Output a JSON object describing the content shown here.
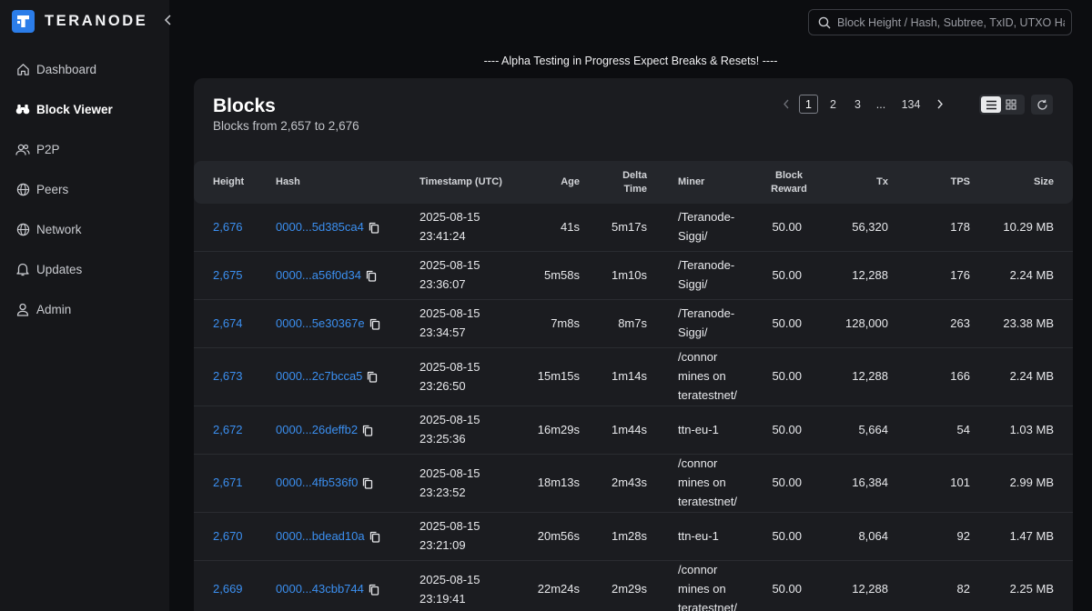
{
  "brand": {
    "name": "TERANODE",
    "logo_icon": "teranode-logo-icon",
    "accent": "#2b7de9"
  },
  "nav": [
    {
      "label": "Dashboard",
      "icon": "home-icon",
      "active": false
    },
    {
      "label": "Block Viewer",
      "icon": "binoculars-icon",
      "active": true
    },
    {
      "label": "P2P",
      "icon": "users-icon",
      "active": false
    },
    {
      "label": "Peers",
      "icon": "globe-icon",
      "active": false
    },
    {
      "label": "Network",
      "icon": "globe-icon",
      "active": false
    },
    {
      "label": "Updates",
      "icon": "bell-icon",
      "active": false
    },
    {
      "label": "Admin",
      "icon": "user-icon",
      "active": false
    }
  ],
  "search": {
    "placeholder": "Block Height / Hash, Subtree, TxID, UTXO Hash"
  },
  "banner": "---- Alpha Testing in Progress Expect Breaks & Resets! ----",
  "card": {
    "title": "Blocks",
    "subtitle": "Blocks from 2,657 to 2,676"
  },
  "pagination": {
    "pages": [
      "1",
      "2",
      "3",
      "...",
      "134"
    ],
    "current": "1"
  },
  "view_mode": "list",
  "table": {
    "headers": {
      "height": "Height",
      "hash": "Hash",
      "timestamp": "Timestamp (UTC)",
      "age": "Age",
      "delta_1": "Delta",
      "delta_2": "Time",
      "miner": "Miner",
      "reward_1": "Block",
      "reward_2": "Reward",
      "tx": "Tx",
      "tps": "TPS",
      "size": "Size"
    },
    "rows": [
      {
        "height": "2,676",
        "hash": "0000...5d385ca4",
        "date": "2025-08-15",
        "time": "23:41:24",
        "age": "41s",
        "delta": "5m17s",
        "miner_1": "/Teranode-",
        "miner_2": "Siggi/",
        "miner_3": "",
        "reward": "50.00",
        "tx": "56,320",
        "tps": "178",
        "size": "10.29 MB"
      },
      {
        "height": "2,675",
        "hash": "0000...a56f0d34",
        "date": "2025-08-15",
        "time": "23:36:07",
        "age": "5m58s",
        "delta": "1m10s",
        "miner_1": "/Teranode-",
        "miner_2": "Siggi/",
        "miner_3": "",
        "reward": "50.00",
        "tx": "12,288",
        "tps": "176",
        "size": "2.24 MB"
      },
      {
        "height": "2,674",
        "hash": "0000...5e30367e",
        "date": "2025-08-15",
        "time": "23:34:57",
        "age": "7m8s",
        "delta": "8m7s",
        "miner_1": "/Teranode-",
        "miner_2": "Siggi/",
        "miner_3": "",
        "reward": "50.00",
        "tx": "128,000",
        "tps": "263",
        "size": "23.38 MB"
      },
      {
        "height": "2,673",
        "hash": "0000...2c7bcca5",
        "date": "2025-08-15",
        "time": "23:26:50",
        "age": "15m15s",
        "delta": "1m14s",
        "miner_1": "/connor",
        "miner_2": "mines on",
        "miner_3": "teratestnet/",
        "reward": "50.00",
        "tx": "12,288",
        "tps": "166",
        "size": "2.24 MB"
      },
      {
        "height": "2,672",
        "hash": "0000...26deffb2",
        "date": "2025-08-15",
        "time": "23:25:36",
        "age": "16m29s",
        "delta": "1m44s",
        "miner_1": "ttn-eu-1",
        "miner_2": "",
        "miner_3": "",
        "reward": "50.00",
        "tx": "5,664",
        "tps": "54",
        "size": "1.03 MB"
      },
      {
        "height": "2,671",
        "hash": "0000...4fb536f0",
        "date": "2025-08-15",
        "time": "23:23:52",
        "age": "18m13s",
        "delta": "2m43s",
        "miner_1": "/connor",
        "miner_2": "mines on",
        "miner_3": "teratestnet/",
        "reward": "50.00",
        "tx": "16,384",
        "tps": "101",
        "size": "2.99 MB"
      },
      {
        "height": "2,670",
        "hash": "0000...bdead10a",
        "date": "2025-08-15",
        "time": "23:21:09",
        "age": "20m56s",
        "delta": "1m28s",
        "miner_1": "ttn-eu-1",
        "miner_2": "",
        "miner_3": "",
        "reward": "50.00",
        "tx": "8,064",
        "tps": "92",
        "size": "1.47 MB"
      },
      {
        "height": "2,669",
        "hash": "0000...43cbb744",
        "date": "2025-08-15",
        "time": "23:19:41",
        "age": "22m24s",
        "delta": "2m29s",
        "miner_1": "/connor",
        "miner_2": "mines on",
        "miner_3": "teratestnet/",
        "reward": "50.00",
        "tx": "12,288",
        "tps": "82",
        "size": "2.25 MB"
      }
    ]
  }
}
